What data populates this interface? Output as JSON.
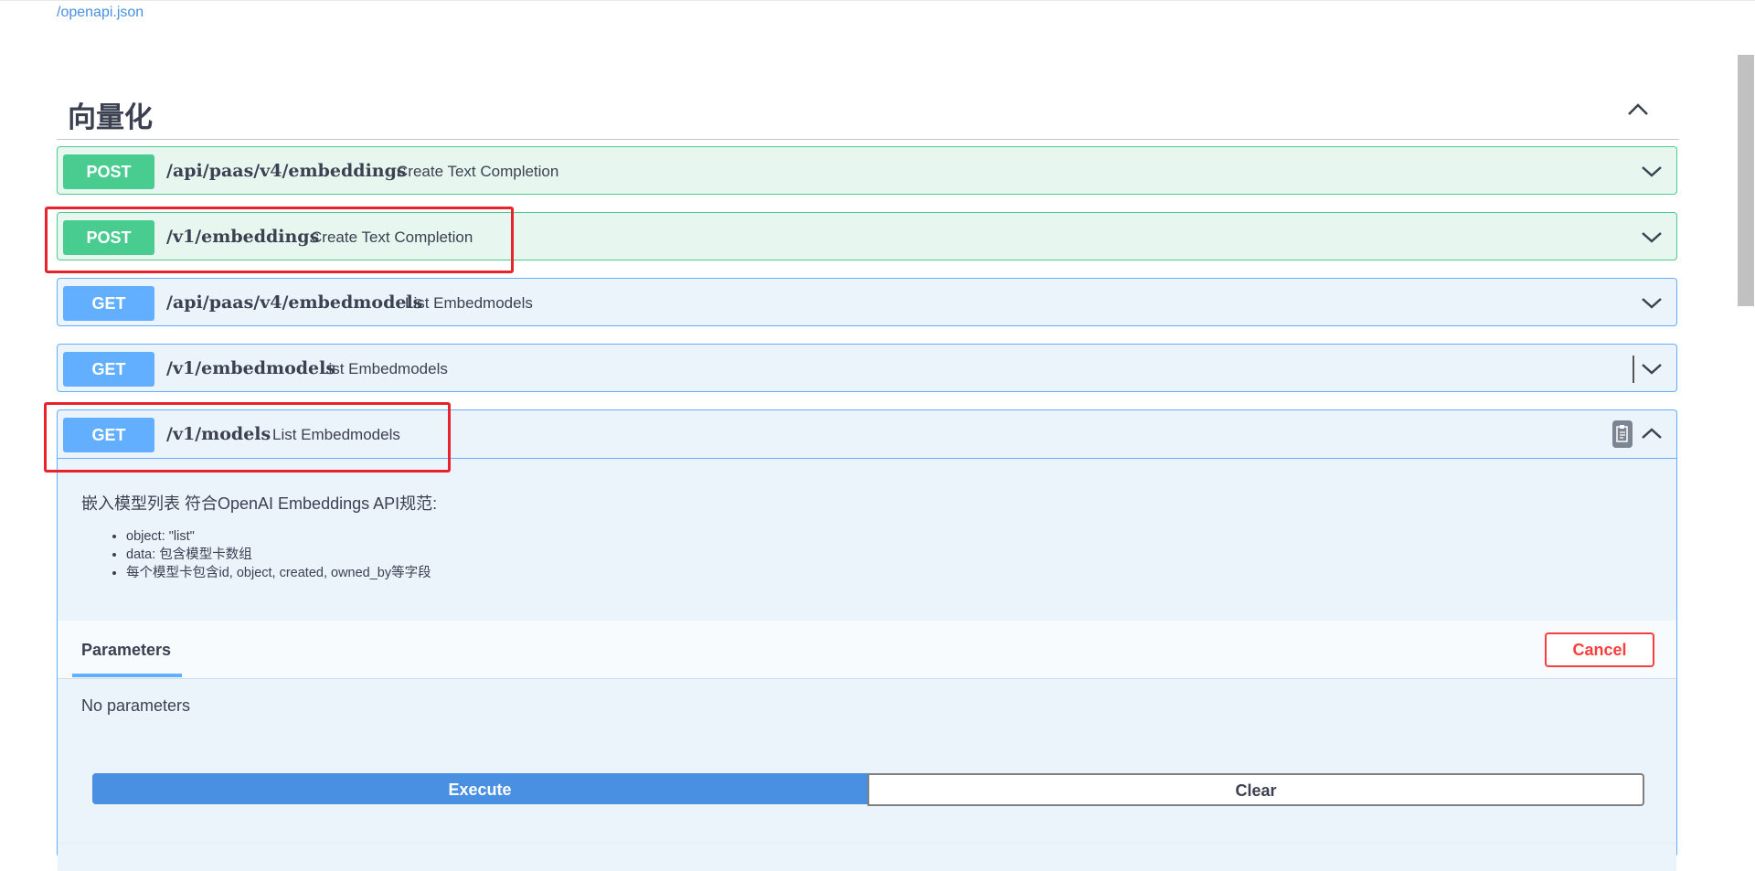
{
  "header": {
    "openapi_link": "/openapi.json"
  },
  "section": {
    "title": "向量化"
  },
  "operations": [
    {
      "method": "POST",
      "path": "/api/paas/v4/embeddings",
      "summary": "Create Text Completion"
    },
    {
      "method": "POST",
      "path": "/v1/embeddings",
      "summary": "Create Text Completion"
    },
    {
      "method": "GET",
      "path": "/api/paas/v4/embedmodels",
      "summary": "List Embedmodels"
    },
    {
      "method": "GET",
      "path": "/v1/embedmodels",
      "summary": "List Embedmodels"
    },
    {
      "method": "GET",
      "path": "/v1/models",
      "summary": "List Embedmodels"
    }
  ],
  "expanded": {
    "description": "嵌入模型列表 符合OpenAI Embeddings API规范:",
    "bullets": [
      "object: \"list\"",
      "data: 包含模型卡数组",
      "每个模型卡包含id, object, created, owned_by等字段"
    ],
    "parameters_tab": "Parameters",
    "cancel_label": "Cancel",
    "no_parameters": "No parameters",
    "execute_label": "Execute",
    "clear_label": "Clear"
  },
  "colors": {
    "post": "#49cc90",
    "get": "#61affe",
    "execute": "#4990e2",
    "cancel": "#f93e3e",
    "highlight": "#e8232b"
  },
  "icons": {
    "section_toggle": "chevron-up-icon",
    "collapsed": "chevron-down-icon",
    "expanded": "chevron-up-icon",
    "copy": "clipboard-icon"
  }
}
